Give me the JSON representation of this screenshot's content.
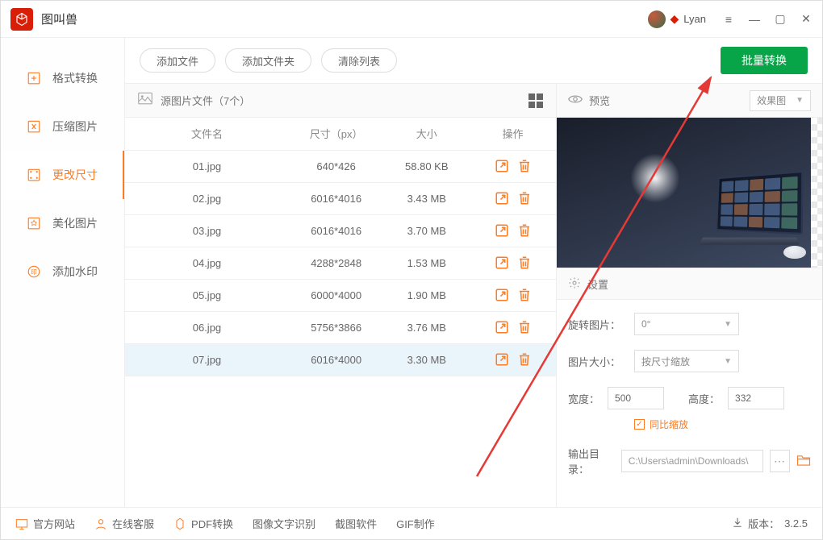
{
  "app": {
    "title": "图叫兽",
    "username": "Lyan"
  },
  "nav": {
    "items": [
      {
        "label": "格式转换"
      },
      {
        "label": "压缩图片"
      },
      {
        "label": "更改尺寸"
      },
      {
        "label": "美化图片"
      },
      {
        "label": "添加水印"
      }
    ]
  },
  "toolbar": {
    "add_file": "添加文件",
    "add_folder": "添加文件夹",
    "clear_list": "清除列表",
    "batch_convert": "批量转换"
  },
  "files": {
    "header": "源图片文件（7个）",
    "columns": {
      "name": "文件名",
      "dimensions": "尺寸（px）",
      "size": "大小",
      "actions": "操作"
    },
    "rows": [
      {
        "name": "01.jpg",
        "dim": "640*426",
        "size": "58.80 KB"
      },
      {
        "name": "02.jpg",
        "dim": "6016*4016",
        "size": "3.43 MB"
      },
      {
        "name": "03.jpg",
        "dim": "6016*4016",
        "size": "3.70 MB"
      },
      {
        "name": "04.jpg",
        "dim": "4288*2848",
        "size": "1.53 MB"
      },
      {
        "name": "05.jpg",
        "dim": "6000*4000",
        "size": "1.90 MB"
      },
      {
        "name": "06.jpg",
        "dim": "5756*3866",
        "size": "3.76 MB"
      },
      {
        "name": "07.jpg",
        "dim": "6016*4000",
        "size": "3.30 MB"
      }
    ],
    "selected_index": 6
  },
  "preview": {
    "title": "预览",
    "mode": "效果图"
  },
  "settings": {
    "title": "设置",
    "rotate_label": "旋转图片：",
    "rotate_value": "0°",
    "size_mode_label": "图片大小：",
    "size_mode_value": "按尺寸缩放",
    "width_label": "宽度：",
    "width_value": "500",
    "height_label": "高度：",
    "height_value": "332",
    "keep_ratio_label": "同比缩放",
    "output_label": "输出目录：",
    "output_path": "C:\\Users\\admin\\Downloads\\"
  },
  "footer": {
    "official_site": "官方网站",
    "support": "在线客服",
    "pdf": "PDF转换",
    "ocr": "图像文字识别",
    "screenshot": "截图软件",
    "gif": "GIF制作",
    "version_label": "版本：",
    "version": "3.2.5"
  }
}
